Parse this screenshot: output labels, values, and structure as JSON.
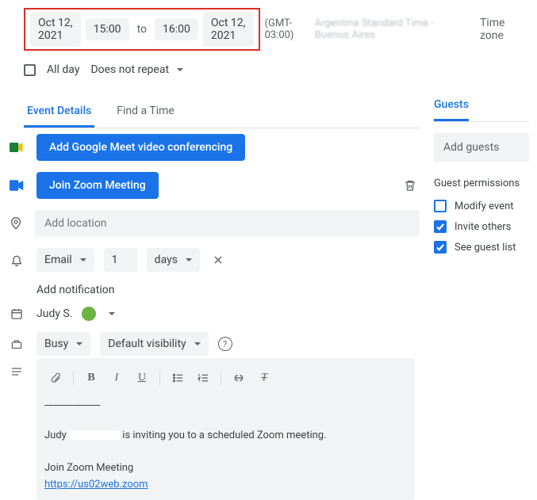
{
  "datetime": {
    "start_date": "Oct 12, 2021",
    "start_time": "15:00",
    "to": "to",
    "end_time": "16:00",
    "end_date": "Oct 12, 2021",
    "tz_offset": "(GMT-03:00)",
    "tz_name": "Argentina Standard Time - Buenos Aires",
    "tz_label": "Time zone"
  },
  "allday": {
    "label": "All day",
    "repeat": "Does not repeat"
  },
  "tabs": {
    "details": "Event Details",
    "find": "Find a Time"
  },
  "meet": {
    "add": "Add Google Meet video conferencing",
    "join": "Join Zoom Meeting"
  },
  "location": {
    "placeholder": "Add location"
  },
  "notification": {
    "method": "Email",
    "qty": "1",
    "unit": "days",
    "add": "Add notification"
  },
  "owner": {
    "name": "Judy S."
  },
  "availability": {
    "status": "Busy",
    "visibility": "Default visibility"
  },
  "description": {
    "line1a": "Judy",
    "line1b": "is inviting you to a scheduled Zoom meeting.",
    "line2": "Join Zoom Meeting",
    "link": "https://us02web.zoom"
  },
  "guests": {
    "header": "Guests",
    "placeholder": "Add guests",
    "perm_header": "Guest permissions",
    "modify": "Modify event",
    "invite": "Invite others",
    "see": "See guest list"
  }
}
